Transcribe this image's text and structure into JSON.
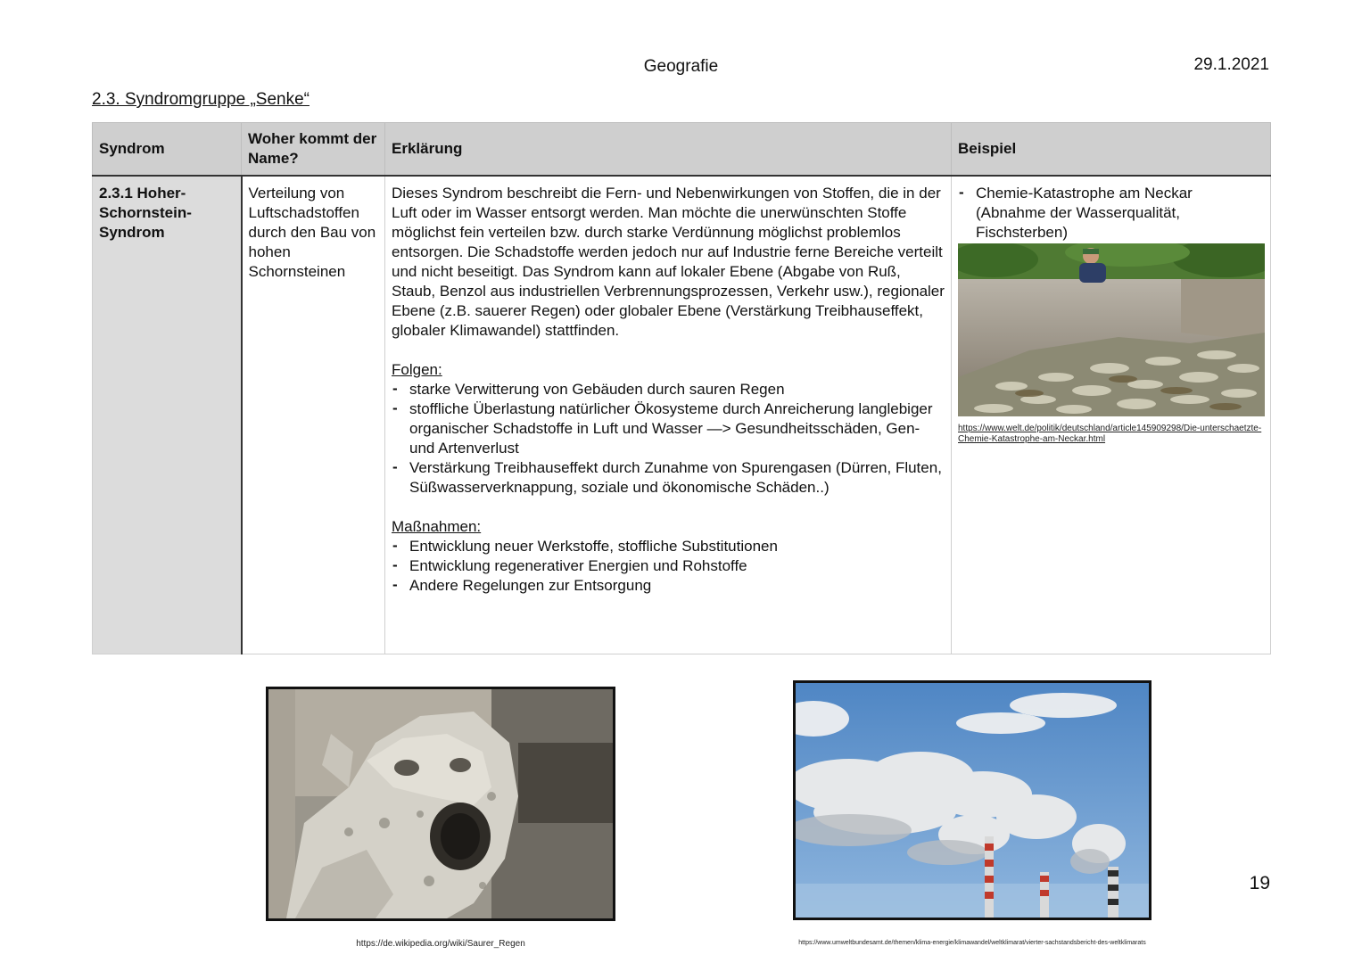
{
  "header": {
    "subject": "Geografie",
    "date": "29.1.2021",
    "section_title": "2.3. Syndromgruppe „Senke“"
  },
  "table": {
    "headers": [
      "Syndrom",
      "Woher kommt der Name?",
      "Erklärung",
      "Beispiel"
    ],
    "row": {
      "syndrom": "2.3.1 Hoher-Schornstein-Syndrom",
      "name_origin": "Verteilung von Luftschadstoffen durch den Bau von hohen Schornsteinen",
      "explanation": "Dieses Syndrom beschreibt die Fern- und Nebenwirkungen von Stoffen, die in der Luft oder im Wasser entsorgt werden. Man möchte die unerwünschten Stoffe möglichst fein verteilen bzw. durch starke Verdünnung möglichst problemlos entsorgen. Die Schadstoffe werden jedoch nur auf Industrie ferne Bereiche verteilt und nicht beseitigt. Das Syndrom kann auf lokaler Ebene (Abgabe von Ruß, Staub, Benzol aus industriellen Verbrennungsprozessen, Verkehr usw.), regionaler Ebene (z.B. sauerer Regen) oder globaler Ebene (Verstärkung Treibhauseffekt, globaler Klimawandel) stattfinden.",
      "folgen_heading": "Folgen:",
      "folgen": [
        "starke Verwitterung von Gebäuden durch sauren Regen",
        "stoffliche Überlastung natürlicher Ökosysteme durch Anreicherung langlebiger organischer Schadstoffe in Luft und Wasser —> Gesundheitsschäden, Gen- und Artenverlust",
        "Verstärkung Treibhauseffekt durch Zunahme von Spurengasen (Dürren, Fluten, Süßwasserverknappung, soziale und ökonomische Schäden..)"
      ],
      "massnahmen_heading": "Maßnahmen:",
      "massnahmen": [
        "Entwicklung neuer Werkstoffe, stoffliche Substitutionen",
        "Entwicklung regenerativer Energien und Rohstoffe",
        "Andere Regelungen zur Entsorgung"
      ],
      "example": "Chemie-Katastrophe am Neckar (Abnahme der Wasserqualität, Fischsterben)",
      "example_source": "https://www.welt.de/politik/deutschland/article145909298/Die-unterschaetzte-Chemie-Katastrophe-am-Neckar.html"
    }
  },
  "images": {
    "gargoyle_caption": "https://de.wikipedia.org/wiki/Saurer_Regen",
    "chimney_caption": "https://www.umweltbundesamt.de/themen/klima-energie/klimawandel/weltklimarat/vierter-sachstandsbericht-des-weltklimarats"
  },
  "page_number": "19"
}
